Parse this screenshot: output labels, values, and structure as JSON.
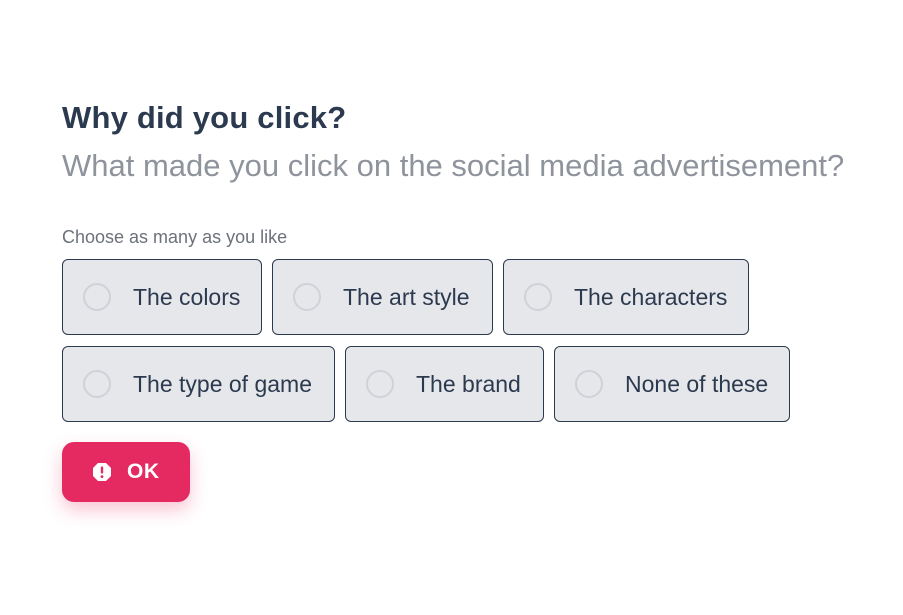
{
  "question": {
    "title": "Why did you click?",
    "description": "What made you click on the social media advertisement?"
  },
  "hint": "Choose as many as you like",
  "choices": [
    {
      "label": "The colors",
      "checked": false
    },
    {
      "label": "The art style",
      "checked": false
    },
    {
      "label": "The characters",
      "checked": false
    },
    {
      "label": "The type of game",
      "checked": false
    },
    {
      "label": "The brand",
      "checked": false
    },
    {
      "label": "None of these",
      "checked": false
    }
  ],
  "ok_button": {
    "label": "OK",
    "icon": "alert-icon",
    "color": "#e52a62"
  },
  "colors": {
    "text": "#2c3a4f",
    "muted": "#8e939c",
    "choice_bg": "#e6e7ea",
    "accent": "#e52a62"
  }
}
